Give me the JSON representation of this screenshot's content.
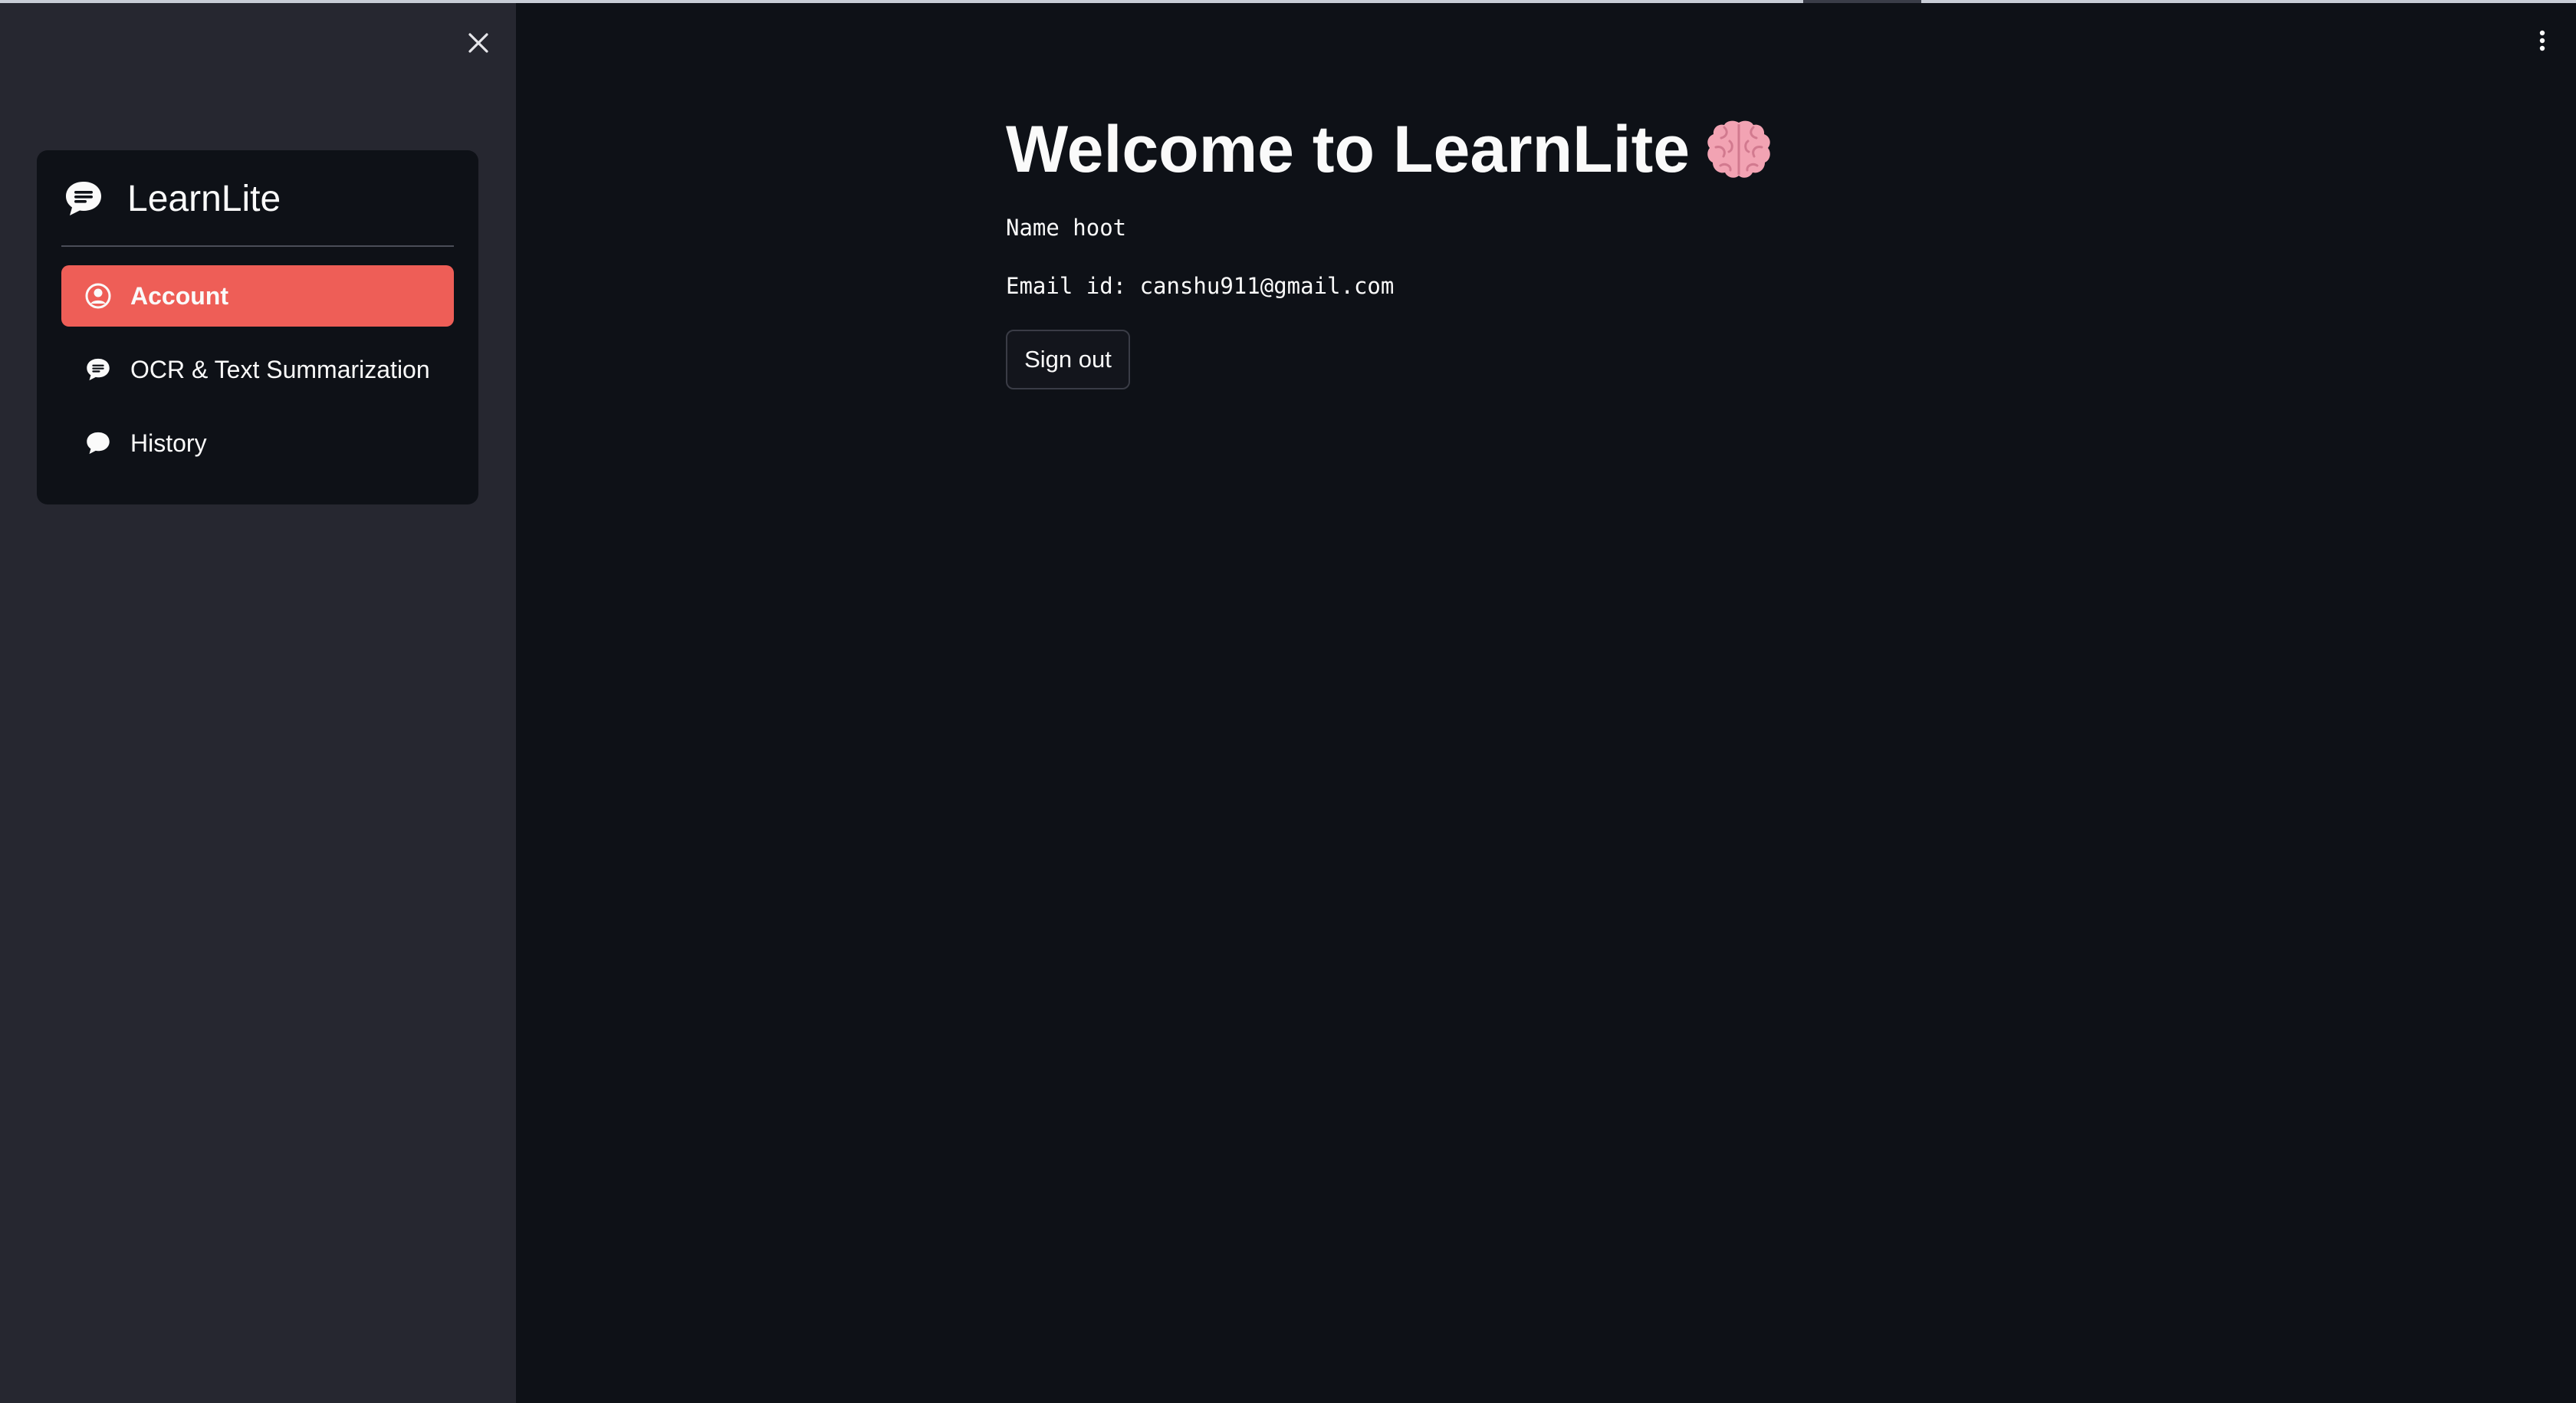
{
  "sidebar": {
    "close_icon": "close-icon",
    "nav": {
      "title": "LearnLite",
      "header_icon": "chat-text-icon",
      "items": [
        {
          "label": "Account",
          "icon": "person-circle-icon",
          "active": true
        },
        {
          "label": "OCR & Text Summarization",
          "icon": "chat-text-icon",
          "active": false
        },
        {
          "label": "History",
          "icon": "chat-bubble-icon",
          "active": false
        }
      ],
      "active_color": "#ee5e57"
    }
  },
  "header": {
    "menu_icon": "vertical-ellipsis-icon"
  },
  "main": {
    "title": "Welcome to LearnLite",
    "title_icon": "brain-icon",
    "name_line": "Name hoot",
    "email_line": "Email id: canshu911@gmail.com",
    "signout_label": "Sign out"
  },
  "colors": {
    "background": "#0e1117",
    "sidebar": "#262730",
    "text": "#fafafa"
  }
}
